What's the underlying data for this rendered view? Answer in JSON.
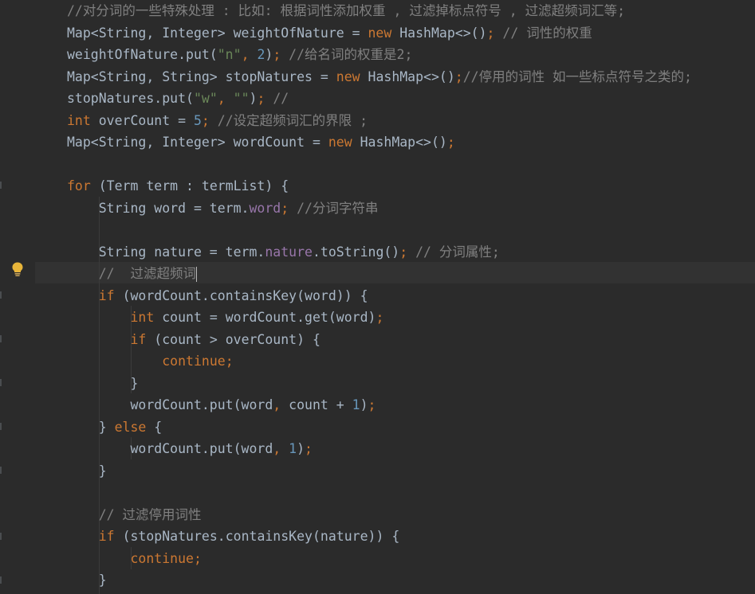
{
  "editor": {
    "lines": [
      [
        [
          "cmt",
          "//对分词的一些特殊处理 : 比如: 根据词性添加权重 , 过滤掉标点符号 , 过滤超频词汇等;"
        ]
      ],
      [
        [
          "txt",
          "Map<String, Integer> weightOfNature = "
        ],
        [
          "kw",
          "new "
        ],
        [
          "txt",
          "HashMap<>()"
        ],
        [
          "kw",
          ";"
        ],
        [
          "cmt",
          " // 词性的权重"
        ]
      ],
      [
        [
          "txt",
          "weightOfNature.put("
        ],
        [
          "str",
          "\"n\""
        ],
        [
          "kw",
          ", "
        ],
        [
          "num",
          "2"
        ],
        [
          "txt",
          ")"
        ],
        [
          "kw",
          ";"
        ],
        [
          "cmt",
          " //给名词的权重是2;"
        ]
      ],
      [
        [
          "txt",
          "Map<String, String> stopNatures = "
        ],
        [
          "kw",
          "new "
        ],
        [
          "txt",
          "HashMap<>()"
        ],
        [
          "kw",
          ";"
        ],
        [
          "cmt",
          "//停用的词性 如一些标点符号之类的;"
        ]
      ],
      [
        [
          "txt",
          "stopNatures.put("
        ],
        [
          "str",
          "\"w\""
        ],
        [
          "kw",
          ", "
        ],
        [
          "str",
          "\"\""
        ],
        [
          "txt",
          ")"
        ],
        [
          "kw",
          ";"
        ],
        [
          "cmt",
          " //"
        ]
      ],
      [
        [
          "kw",
          "int "
        ],
        [
          "txt",
          "overCount = "
        ],
        [
          "num",
          "5"
        ],
        [
          "kw",
          ";"
        ],
        [
          "cmt",
          " //设定超频词汇的界限 ;"
        ]
      ],
      [
        [
          "txt",
          "Map<String, Integer> wordCount = "
        ],
        [
          "kw",
          "new "
        ],
        [
          "txt",
          "HashMap<>()"
        ],
        [
          "kw",
          ";"
        ]
      ],
      [],
      [
        [
          "kw",
          "for "
        ],
        [
          "txt",
          "(Term term : termList) {"
        ]
      ],
      [
        [
          "txt",
          "    String word = term."
        ],
        [
          "fld",
          "word"
        ],
        [
          "kw",
          ";"
        ],
        [
          "cmt",
          " //分词字符串"
        ]
      ],
      [],
      [
        [
          "txt",
          "    String nature = term."
        ],
        [
          "fld",
          "nature"
        ],
        [
          "txt",
          ".toString()"
        ],
        [
          "kw",
          ";"
        ],
        [
          "cmt",
          " // 分词属性;"
        ]
      ],
      [
        [
          "cmt",
          "    //  过滤超频词"
        ]
      ],
      [
        [
          "txt",
          "    "
        ],
        [
          "kw",
          "if "
        ],
        [
          "txt",
          "(wordCount.containsKey(word)) {"
        ]
      ],
      [
        [
          "txt",
          "        "
        ],
        [
          "kw",
          "int "
        ],
        [
          "txt",
          "count = wordCount.get(word)"
        ],
        [
          "kw",
          ";"
        ]
      ],
      [
        [
          "txt",
          "        "
        ],
        [
          "kw",
          "if "
        ],
        [
          "txt",
          "(count > overCount) {"
        ]
      ],
      [
        [
          "txt",
          "            "
        ],
        [
          "kw",
          "continue;"
        ]
      ],
      [
        [
          "txt",
          "        }"
        ]
      ],
      [
        [
          "txt",
          "        wordCount.put(word"
        ],
        [
          "kw",
          ", "
        ],
        [
          "txt",
          "count + "
        ],
        [
          "num",
          "1"
        ],
        [
          "txt",
          ")"
        ],
        [
          "kw",
          ";"
        ]
      ],
      [
        [
          "txt",
          "    } "
        ],
        [
          "kw",
          "else "
        ],
        [
          "txt",
          "{"
        ]
      ],
      [
        [
          "txt",
          "        wordCount.put(word"
        ],
        [
          "kw",
          ", "
        ],
        [
          "num",
          "1"
        ],
        [
          "txt",
          ")"
        ],
        [
          "kw",
          ";"
        ]
      ],
      [
        [
          "txt",
          "    }"
        ]
      ],
      [],
      [
        [
          "cmt",
          "    // 过滤停用词性"
        ]
      ],
      [
        [
          "txt",
          "    "
        ],
        [
          "kw",
          "if "
        ],
        [
          "txt",
          "(stopNatures.containsKey(nature)) {"
        ]
      ],
      [
        [
          "txt",
          "        "
        ],
        [
          "kw",
          "continue;"
        ]
      ],
      [
        [
          "txt",
          "    }"
        ]
      ]
    ]
  },
  "gutter": {
    "bulb_icon": "lightbulb-icon",
    "bulb_color": "#e8b53a"
  },
  "colors": {
    "background": "#2b2b2b",
    "keyword": "#cc7832",
    "comment": "#808080",
    "string": "#6a8759",
    "number": "#6897bb",
    "field": "#9876aa",
    "text": "#a9b7c6"
  }
}
